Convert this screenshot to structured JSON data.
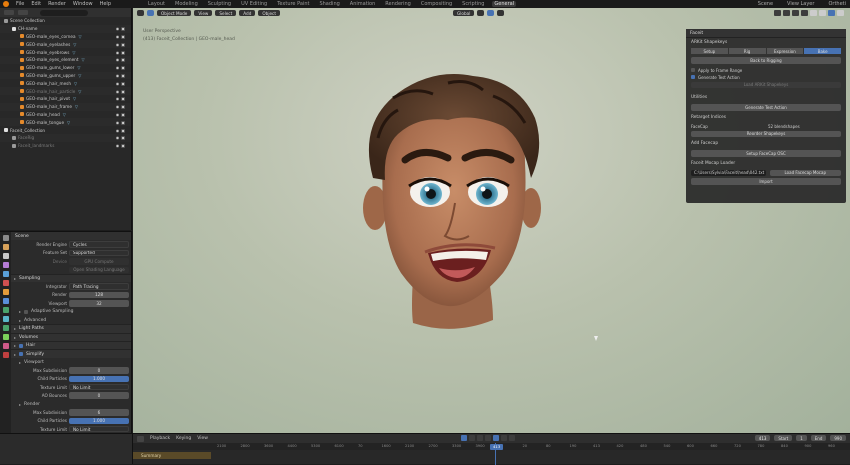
{
  "topbar": {
    "menus": [
      "File",
      "Edit",
      "Render",
      "Window",
      "Help"
    ],
    "workspaces": [
      {
        "label": "Layout",
        "active": false
      },
      {
        "label": "Modeling",
        "active": false
      },
      {
        "label": "Sculpting",
        "active": false
      },
      {
        "label": "UV Editing",
        "active": false
      },
      {
        "label": "Texture Paint",
        "active": false
      },
      {
        "label": "Shading",
        "active": false
      },
      {
        "label": "Animation",
        "active": false
      },
      {
        "label": "Rendering",
        "active": false
      },
      {
        "label": "Compositing",
        "active": false
      },
      {
        "label": "Scripting",
        "active": false
      },
      {
        "label": "General",
        "active": true
      }
    ],
    "scene_label": "Scene",
    "view_layer_label": "View Layer",
    "right_extra": "Ortheti"
  },
  "outliner": {
    "rows": [
      {
        "label": "Scene Collection",
        "indent": 0,
        "color": "#9a9a9a",
        "dim": false
      },
      {
        "label": "CH-name",
        "indent": 1,
        "color": "#e0e0e0",
        "dim": false
      },
      {
        "label": "GEO-male_eyes_cornea",
        "indent": 2,
        "color": "#e58a2b",
        "dim": false
      },
      {
        "label": "GEO-male_eyelashes",
        "indent": 2,
        "color": "#e58a2b",
        "dim": false
      },
      {
        "label": "GEO-male_eyebrows",
        "indent": 2,
        "color": "#e58a2b",
        "dim": false
      },
      {
        "label": "GEO-male_eyes_element",
        "indent": 2,
        "color": "#e58a2b",
        "dim": false
      },
      {
        "label": "GEO-male_gums_lower",
        "indent": 2,
        "color": "#e58a2b",
        "dim": false
      },
      {
        "label": "GEO-male_gums_upper",
        "indent": 2,
        "color": "#e58a2b",
        "dim": false
      },
      {
        "label": "GEO-male_hair_mesh",
        "indent": 2,
        "color": "#e58a2b",
        "dim": false
      },
      {
        "label": "GEO-male_hair_particle",
        "indent": 2,
        "color": "#e58a2b",
        "dim": true
      },
      {
        "label": "GEO-male_hair_pivot",
        "indent": 2,
        "color": "#e58a2b",
        "dim": false
      },
      {
        "label": "GEO-male_hair_frame",
        "indent": 2,
        "color": "#e58a2b",
        "dim": false
      },
      {
        "label": "GEO-male_head",
        "indent": 2,
        "color": "#e58a2b",
        "dim": false
      },
      {
        "label": "GEO-male_tongue",
        "indent": 2,
        "color": "#e58a2b",
        "dim": false
      },
      {
        "label": "Faceit_Collection",
        "indent": 0,
        "color": "#e0e0e0",
        "dim": false
      },
      {
        "label": "FaceRig",
        "indent": 1,
        "color": "#9a9a9a",
        "dim": true
      },
      {
        "label": "Faceit_landmarks",
        "indent": 1,
        "color": "#9a9a9a",
        "dim": true
      }
    ]
  },
  "properties": {
    "header": "Scene",
    "rows": [
      {
        "type": "kv",
        "key": "Render Engine",
        "value": "Cycles",
        "style": "dd"
      },
      {
        "type": "kv",
        "key": "Feature Set",
        "value": "Supported",
        "style": "dd"
      },
      {
        "type": "kv",
        "key": "Device",
        "value": "GPU Compute",
        "style": "dis"
      },
      {
        "type": "kv",
        "key": "",
        "value": "Open Shading Language",
        "style": "dis"
      },
      {
        "type": "section",
        "label": "Sampling"
      },
      {
        "type": "kv",
        "key": "Integrator",
        "value": "Path Tracing",
        "style": "dd"
      },
      {
        "type": "kv",
        "key": "Render",
        "value": "128",
        "style": "num"
      },
      {
        "type": "kv",
        "key": "Viewport",
        "value": "32",
        "style": "num"
      },
      {
        "type": "sub",
        "label": "Adaptive Sampling"
      },
      {
        "type": "sub",
        "label": "Advanced"
      },
      {
        "type": "section",
        "label": "Light Paths"
      },
      {
        "type": "section",
        "label": "Volumes"
      },
      {
        "type": "section",
        "label": "Hair"
      },
      {
        "type": "section",
        "label": "Simplify"
      },
      {
        "type": "sub",
        "label": "Viewport"
      },
      {
        "type": "kv",
        "key": "Max Subdivision",
        "value": "0",
        "style": "num"
      },
      {
        "type": "kv",
        "key": "Child Particles",
        "value": "1.000",
        "style": "blue"
      },
      {
        "type": "kv",
        "key": "Texture Limit",
        "value": "No Limit",
        "style": "dd"
      },
      {
        "type": "kv",
        "key": "AO Bounces",
        "value": "0",
        "style": "num"
      },
      {
        "type": "sub",
        "label": "Render"
      },
      {
        "type": "kv",
        "key": "Max Subdivision",
        "value": "6",
        "style": "num"
      },
      {
        "type": "kv",
        "key": "Child Particles",
        "value": "1.000",
        "style": "blue"
      },
      {
        "type": "kv",
        "key": "Texture Limit",
        "value": "No Limit",
        "style": "dd"
      }
    ]
  },
  "viewport": {
    "header": {
      "mode": "Object Mode",
      "menus": [
        "View",
        "Select",
        "Add",
        "Object"
      ],
      "transform": "Global"
    },
    "title": "User Perspective",
    "info": "(413) Faceit_Collection | GEO-male_head"
  },
  "npanel": {
    "title": "Faceit",
    "arkit_label": "ARKit Shapekeys",
    "tabs": [
      {
        "label": "Setup",
        "on": false
      },
      {
        "label": "Rig",
        "on": false
      },
      {
        "label": "Expression",
        "on": false
      },
      {
        "label": "Bake",
        "on": true
      }
    ],
    "back_button": "Back to Rigging",
    "opt1": "Apply to Frame Range",
    "opt2": "Generate Test Action",
    "disabled_button": "Load ARKit Shapekeys",
    "utils_label": "Utilities",
    "test_action_button": "Generate Test Action",
    "retarget_label": "Retarget Indices",
    "facecap_label": "FaceCap",
    "indices_label": "52 blendshapes",
    "reorder_button": "Reorder Shapekeys",
    "addfacecap_label": "Add Facecap",
    "setup_facecap_button": "Setup FaceCap OSC",
    "mocap_label": "Faceit Mocap Loader",
    "path_value": "C:\\Users\\Sylvia\\Faceit\\head\\042.txt",
    "load_mocap_button": "Load Facecap Mocap",
    "import_button": "Import"
  },
  "timeline": {
    "menus": [
      "Playback",
      "Keying",
      "View"
    ],
    "current_frame": "413",
    "start_label": "Start",
    "start_value": "1",
    "end_label": "End",
    "end_value": "990",
    "ticks": [
      "2100",
      "2800",
      "3600",
      "4400",
      "5300",
      "6100",
      "70",
      "1600",
      "2100",
      "2700",
      "3300",
      "3900",
      "0",
      "20",
      "80",
      "190",
      "413",
      "420",
      "480",
      "540",
      "600",
      "660",
      "720",
      "780",
      "840",
      "900",
      "960"
    ],
    "cursor_label": "413",
    "summary_label": "Summary"
  }
}
